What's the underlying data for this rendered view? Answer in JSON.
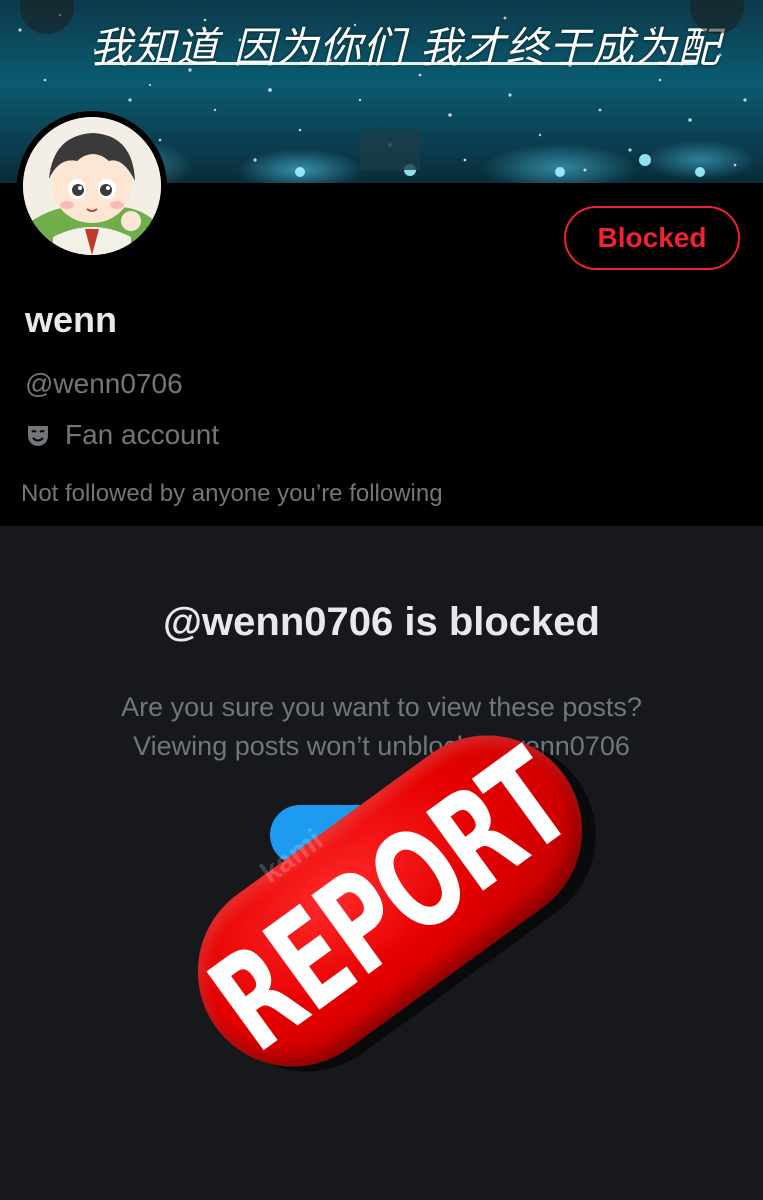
{
  "banner": {
    "caption": "我知道 因为你们 我才终于成为配",
    "image": "concert-stage-confetti"
  },
  "profile": {
    "avatar": "cartoon-boy-avatar",
    "blocked_button_label": "Blocked",
    "display_name": "wenn",
    "handle": "@wenn0706",
    "category_icon": "theater-mask-icon",
    "category_label": "Fan account",
    "followers_note": "Not followed by anyone you’re following"
  },
  "notice": {
    "title": "@wenn0706 is blocked",
    "body_line1": "Are you sure you want to view these posts?",
    "body_line2": "Viewing posts won’t unblock @wenn0706"
  },
  "overlay": {
    "stamp_text": "REPORT",
    "watermark": "kami",
    "stamp_color": "#e60000"
  },
  "colors": {
    "blocked_red": "#f4212e",
    "primary_text": "#e7e9ea",
    "secondary_text": "#71767b",
    "accent_blue": "#1d9bf0"
  }
}
